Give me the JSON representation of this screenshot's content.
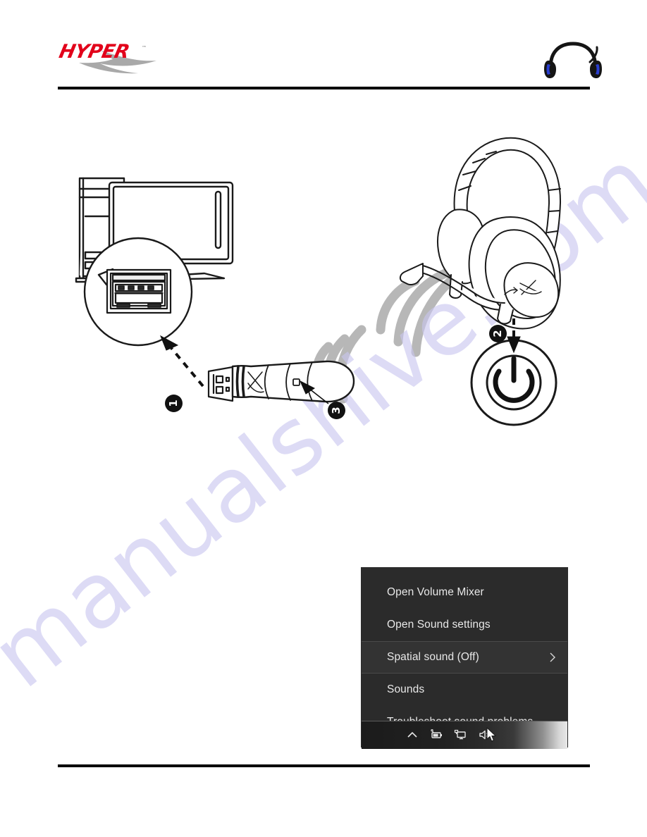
{
  "document": {
    "brand_logo_text": "HYPER",
    "brand_logo_tm": "TM",
    "brand_accent_color": "#e2001a",
    "brand_swoosh_color": "#a8a8a8",
    "watermark_text": "manualshive.com"
  },
  "header": {
    "product_image_name": "wireless-headset-photo"
  },
  "diagram": {
    "callouts": [
      {
        "id": "1",
        "label": "1",
        "meaning": "plug-usb-dongle-into-computer-usb-port"
      },
      {
        "id": "2",
        "label": "2",
        "meaning": "press-headset-power-button"
      },
      {
        "id": "3",
        "label": "3",
        "meaning": "dongle-status-led"
      }
    ],
    "elements": {
      "computer": "desktop-computer-with-monitor",
      "usb_port_zoom": "magnified-usb-port-callout",
      "dongle": "usb-wireless-dongle",
      "headset": "wireless-gaming-headset-line-art",
      "power_button": "power-button-symbol",
      "wireless_waves": "wireless-signal-arcs"
    }
  },
  "context_menu": {
    "items": [
      {
        "label": "Open Volume Mixer",
        "has_submenu": false,
        "highlighted": false
      },
      {
        "label": "Open Sound settings",
        "has_submenu": false,
        "highlighted": false
      },
      {
        "label": "Spatial sound (Off)",
        "has_submenu": true,
        "highlighted": true
      },
      {
        "label": "Sounds",
        "has_submenu": false,
        "highlighted": false
      },
      {
        "label": "Troubleshoot sound problems",
        "has_submenu": false,
        "highlighted": false
      }
    ],
    "background_color": "#2b2b2b",
    "text_color": "#e8e8e8"
  },
  "taskbar": {
    "tray_icons": [
      {
        "name": "show-hidden-icons-chevron",
        "glyph": "chevron-up"
      },
      {
        "name": "battery-icon",
        "glyph": "battery"
      },
      {
        "name": "network-icon",
        "glyph": "monitor-network"
      },
      {
        "name": "volume-icon",
        "glyph": "speaker"
      }
    ],
    "cursor": "mouse-pointer"
  }
}
